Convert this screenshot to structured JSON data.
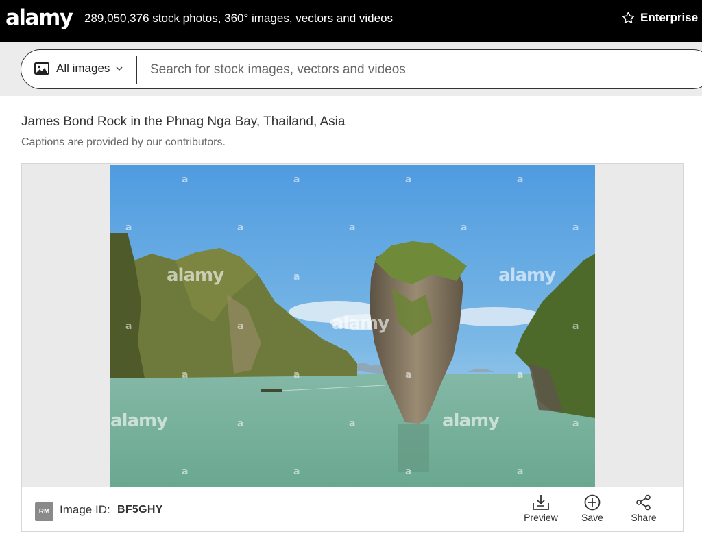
{
  "header": {
    "logo": "alamy",
    "tagline": "289,050,376 stock photos, 360° images, vectors and videos",
    "enterprise_label": "Enterprise"
  },
  "search": {
    "filter_label": "All images",
    "placeholder": "Search for stock images, vectors and videos"
  },
  "image_page": {
    "title": "James Bond Rock in the Phnag Nga Bay, Thailand, Asia",
    "caption_note": "Captions are provided by our contributors.",
    "watermark_text": "alamy",
    "license_badge": "RM",
    "image_id_label": "Image ID:",
    "image_id_value": "BF5GHY",
    "actions": {
      "preview": "Preview",
      "save": "Save",
      "share": "Share"
    }
  },
  "colors": {
    "topbar_bg": "#000000",
    "search_band_bg": "#ececec",
    "panel_bg": "#eaeaea",
    "sky": "#5aa3dd",
    "water": "#7db3a0"
  },
  "icons": [
    "image-icon",
    "chevron-down-icon",
    "star-icon",
    "download-icon",
    "plus-circle-icon",
    "share-icon"
  ]
}
